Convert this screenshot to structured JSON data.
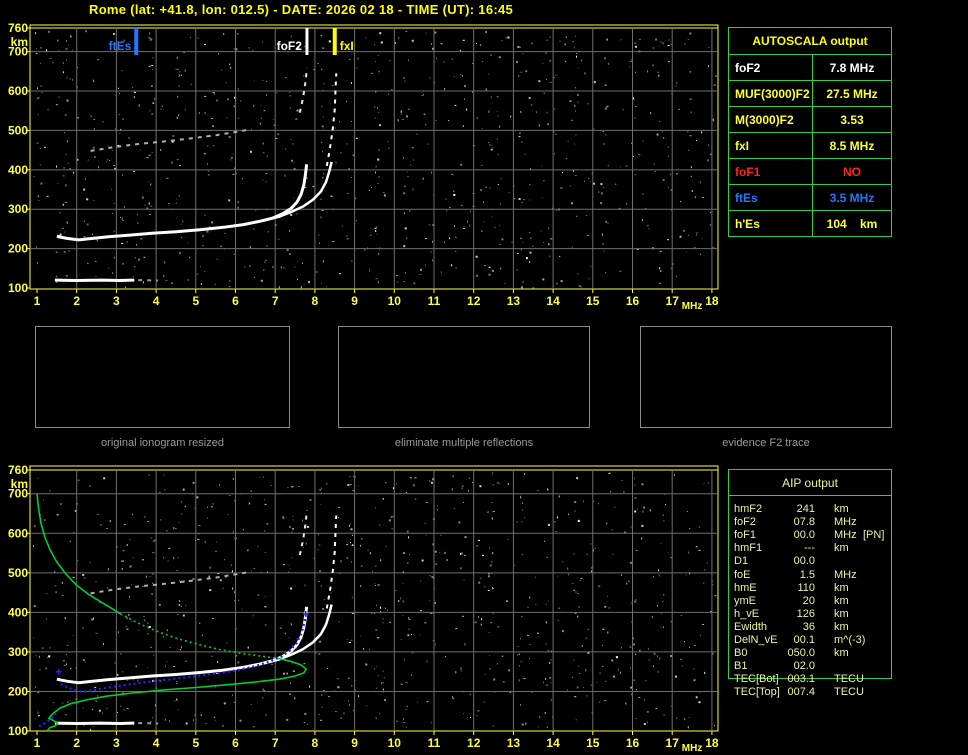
{
  "title": "Rome (lat: +41.8, lon: 012.5) - DATE: 2026 02 18 - TIME (UT): 16:45",
  "colors": {
    "title_yellow": "#ffff00",
    "axis_yellow": "#ffff44",
    "table_green": "#33cc44",
    "aip_text": "#eef2a2",
    "marker_blue": "#2277ff",
    "marker_white": "#ffffff",
    "marker_yellow": "#ffff00",
    "alert_red": "#ff2222",
    "profile_green": "#00cc33",
    "model_blue": "#2222ff",
    "grid_gray": "#6e6e6e",
    "noise_gray": "#9a9a9a"
  },
  "autoscala_table": {
    "header": "AUTOSCALA output",
    "rows": [
      {
        "label": "foF2",
        "value": "7.8 MHz",
        "color": "#ffffff"
      },
      {
        "label": "MUF(3000)F2",
        "value": "27.5 MHz",
        "color": "#ffff33"
      },
      {
        "label": "M(3000)F2",
        "value": "3.53",
        "color": "#ffff33"
      },
      {
        "label": "fxI",
        "value": "8.5 MHz",
        "color": "#ffff33"
      },
      {
        "label": "foF1",
        "value": "NO",
        "color": "#ff2222"
      },
      {
        "label": "ftEs",
        "value": "3.5 MHz",
        "color": "#2277ff"
      },
      {
        "label": "h'Es",
        "value": "104    km",
        "color": "#ffff33"
      }
    ]
  },
  "aip_table": {
    "header": "AIP output",
    "rows": [
      {
        "label": "hmF2",
        "value": "241",
        "unit": "km",
        "extra": ""
      },
      {
        "label": "foF2",
        "value": "07.8",
        "unit": "MHz",
        "extra": ""
      },
      {
        "label": "foF1",
        "value": "00.0",
        "unit": "MHz",
        "extra": "[PN]"
      },
      {
        "label": "hmF1",
        "value": "---",
        "unit": "km",
        "extra": ""
      },
      {
        "label": "D1",
        "value": "00.0",
        "unit": "",
        "extra": ""
      },
      {
        "label": "foE",
        "value": "1.5",
        "unit": "MHz",
        "extra": ""
      },
      {
        "label": "hmE",
        "value": "110",
        "unit": "km",
        "extra": ""
      },
      {
        "label": "ymE",
        "value": "20",
        "unit": "km",
        "extra": ""
      },
      {
        "label": "h_vE",
        "value": "126",
        "unit": "km",
        "extra": ""
      },
      {
        "label": "Ewidth",
        "value": "36",
        "unit": "km",
        "extra": ""
      },
      {
        "label": "DelN_vE",
        "value": "00.1",
        "unit": "m^(-3)",
        "extra": ""
      },
      {
        "label": "B0",
        "value": "050.0",
        "unit": "km",
        "extra": ""
      },
      {
        "label": "B1",
        "value": "02.0",
        "unit": "",
        "extra": ""
      },
      {
        "label": "TEC[Bot]",
        "value": "003.1",
        "unit": "TECU",
        "extra": ""
      },
      {
        "label": "TEC[Top]",
        "value": "007.4",
        "unit": "TECU",
        "extra": ""
      }
    ]
  },
  "panels": [
    {
      "caption": "original ionogram resized"
    },
    {
      "caption": "eliminate multiple reflections"
    },
    {
      "caption": "evidence F2 trace"
    }
  ],
  "chart_data": [
    {
      "type": "scatter",
      "title": "ionogram (virtual height vs frequency)",
      "xlabel": "MHz",
      "ylabel": "km",
      "x_ticks": [
        1,
        2,
        3,
        4,
        5,
        6,
        7,
        8,
        9,
        10,
        11,
        12,
        13,
        14,
        15,
        16,
        17,
        18
      ],
      "y_ticks": [
        760,
        700,
        600,
        500,
        400,
        300,
        200,
        100
      ],
      "xlim": [
        1,
        18
      ],
      "ylim": [
        100,
        760
      ],
      "grid": true,
      "markers": [
        {
          "label": "ftEs",
          "freq": 3.5,
          "color": "#2277ff",
          "side": "left"
        },
        {
          "label": "foF2",
          "freq": 7.8,
          "color": "#ffffff",
          "side": "left"
        },
        {
          "label": "fxI",
          "freq": 8.5,
          "color": "#ffff00",
          "side": "right"
        }
      ],
      "series": [
        {
          "name": "es-layer",
          "color": "#ffffff",
          "style": "solid",
          "width": 3,
          "points": [
            [
              1.45,
              120
            ],
            [
              2.0,
              119
            ],
            [
              2.6,
              120
            ],
            [
              3.1,
              119
            ],
            [
              3.45,
              120
            ]
          ]
        },
        {
          "name": "es-extension",
          "color": "#9a9a9a",
          "style": "dash",
          "width": 2,
          "points": [
            [
              3.55,
              120
            ],
            [
              4.05,
              119
            ]
          ]
        },
        {
          "name": "f2-ordinary",
          "color": "#ffffff",
          "style": "solid",
          "width": 3,
          "points": [
            [
              1.5,
              231
            ],
            [
              1.75,
              226
            ],
            [
              2.05,
              222
            ],
            [
              2.4,
              226
            ],
            [
              2.8,
              230
            ],
            [
              3.3,
              234
            ],
            [
              3.9,
              239
            ],
            [
              4.5,
              243
            ],
            [
              5.1,
              248
            ],
            [
              5.7,
              254
            ],
            [
              6.2,
              261
            ],
            [
              6.6,
              269
            ],
            [
              6.95,
              278
            ],
            [
              7.2,
              289
            ],
            [
              7.4,
              302
            ],
            [
              7.55,
              318
            ],
            [
              7.65,
              337
            ],
            [
              7.72,
              361
            ],
            [
              7.76,
              387
            ],
            [
              7.79,
              414
            ]
          ]
        },
        {
          "name": "f2-extraordinary",
          "color": "#ffffff",
          "style": "solid",
          "width": 2.5,
          "points": [
            [
              6.35,
              264
            ],
            [
              6.75,
              272
            ],
            [
              7.1,
              281
            ],
            [
              7.4,
              293
            ],
            [
              7.7,
              307
            ],
            [
              7.95,
              324
            ],
            [
              8.15,
              345
            ],
            [
              8.28,
              369
            ],
            [
              8.36,
              395
            ],
            [
              8.42,
              420
            ]
          ]
        },
        {
          "name": "second-hop",
          "color": "#b0b0b0",
          "style": "dash",
          "width": 2,
          "points": [
            [
              2.35,
              448
            ],
            [
              2.9,
              457
            ],
            [
              3.5,
              465
            ],
            [
              4.2,
              472
            ],
            [
              4.9,
              480
            ],
            [
              5.5,
              488
            ],
            [
              6.0,
              496
            ],
            [
              6.4,
              503
            ]
          ]
        },
        {
          "name": "hop-tail-ordinary",
          "color": "#e8e8e8",
          "style": "dash",
          "width": 2,
          "points": [
            [
              7.62,
              545
            ],
            [
              7.7,
              582
            ],
            [
              7.76,
              622
            ],
            [
              7.8,
              658
            ]
          ]
        },
        {
          "name": "hop-tail-extraordinary",
          "color": "#ffffff",
          "style": "dash",
          "width": 2,
          "points": [
            [
              8.3,
              410
            ],
            [
              8.38,
              455
            ],
            [
              8.45,
              505
            ],
            [
              8.5,
              555
            ],
            [
              8.52,
              602
            ],
            [
              8.54,
              645
            ]
          ]
        }
      ]
    },
    {
      "type": "scatter",
      "title": "ionogram with AIP electron density profile and model trace",
      "xlabel": "MHz",
      "ylabel": "km",
      "x_ticks": [
        1,
        2,
        3,
        4,
        5,
        6,
        7,
        8,
        9,
        10,
        11,
        12,
        13,
        14,
        15,
        16,
        17,
        18
      ],
      "y_ticks": [
        760,
        700,
        600,
        500,
        400,
        300,
        200,
        100
      ],
      "xlim": [
        1,
        18
      ],
      "ylim": [
        100,
        760
      ],
      "grid": true,
      "shows_ionogram_traces_of_chart": 0,
      "series": [
        {
          "name": "profile-topside",
          "color": "#00cc33",
          "style": "solid",
          "width": 1.6,
          "points": [
            [
              1.0,
              700
            ],
            [
              1.04,
              662
            ],
            [
              1.1,
              625
            ],
            [
              1.2,
              590
            ],
            [
              1.33,
              558
            ],
            [
              1.5,
              527
            ],
            [
              1.72,
              498
            ],
            [
              1.98,
              470
            ],
            [
              2.28,
              447
            ],
            [
              2.6,
              427
            ],
            [
              2.9,
              409
            ],
            [
              3.1,
              396
            ]
          ]
        },
        {
          "name": "profile-dotted",
          "color": "#00cc33",
          "style": "dot",
          "width": 1.6,
          "points": [
            [
              3.1,
              396
            ],
            [
              3.6,
              370
            ],
            [
              4.1,
              349
            ],
            [
              4.6,
              332
            ],
            [
              5.1,
              318
            ],
            [
              5.6,
              306
            ],
            [
              6.1,
              297
            ],
            [
              6.6,
              290
            ],
            [
              7.05,
              284
            ]
          ]
        },
        {
          "name": "profile-peak-and-bottomside",
          "color": "#00cc33",
          "style": "solid",
          "width": 1.6,
          "points": [
            [
              7.05,
              284
            ],
            [
              7.4,
              276
            ],
            [
              7.65,
              267
            ],
            [
              7.78,
              257
            ],
            [
              7.72,
              247
            ],
            [
              7.5,
              239
            ],
            [
              7.1,
              231
            ],
            [
              6.5,
              224
            ],
            [
              5.8,
              217
            ],
            [
              5.0,
              210
            ],
            [
              4.2,
              204
            ],
            [
              3.4,
              196
            ],
            [
              2.75,
              188
            ],
            [
              2.25,
              179
            ],
            [
              1.85,
              169
            ],
            [
              1.58,
              158
            ],
            [
              1.45,
              148
            ],
            [
              1.35,
              139
            ],
            [
              1.3,
              132
            ],
            [
              1.42,
              126
            ],
            [
              1.52,
              119
            ],
            [
              1.45,
              113
            ],
            [
              1.32,
              108
            ],
            [
              1.28,
              103
            ],
            [
              1.3,
              100
            ]
          ]
        },
        {
          "name": "model-f2-trace",
          "color": "#2222ff",
          "style": "dot",
          "width": 2.2,
          "points": [
            [
              1.6,
              219
            ],
            [
              1.78,
              209
            ],
            [
              2.0,
              201
            ],
            [
              2.2,
              200
            ],
            [
              2.45,
              204
            ],
            [
              2.8,
              210
            ],
            [
              3.2,
              216
            ],
            [
              3.7,
              223
            ],
            [
              4.2,
              229
            ],
            [
              4.7,
              235
            ],
            [
              5.2,
              241
            ],
            [
              5.7,
              248
            ],
            [
              6.1,
              255
            ],
            [
              6.5,
              264
            ],
            [
              6.85,
              275
            ],
            [
              7.15,
              288
            ],
            [
              7.38,
              304
            ],
            [
              7.55,
              323
            ],
            [
              7.66,
              347
            ],
            [
              7.73,
              372
            ],
            [
              7.77,
              393
            ]
          ]
        },
        {
          "name": "model-es-dots",
          "color": "#2222ff",
          "style": "dot",
          "width": 2.2,
          "points": [
            [
              1.05,
              112
            ],
            [
              1.15,
              117
            ],
            [
              1.25,
              123
            ],
            [
              1.33,
              129
            ],
            [
              1.42,
              136
            ],
            [
              1.48,
              143
            ]
          ]
        },
        {
          "name": "model-plus-marks",
          "color": "#2222ff",
          "style": "plus",
          "width": 1.5,
          "points": [
            [
              1.55,
              250
            ],
            [
              7.77,
              396
            ]
          ]
        }
      ]
    }
  ]
}
